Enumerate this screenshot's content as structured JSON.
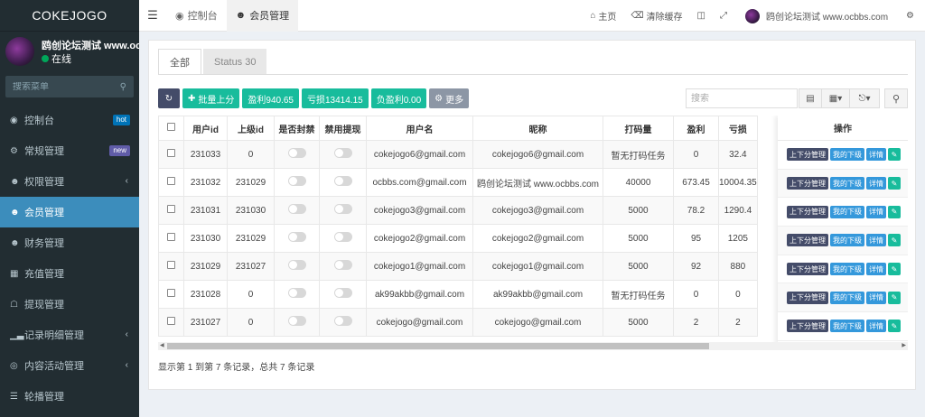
{
  "sidebar": {
    "logo": "COKEJOGO",
    "user_name": "鸥创论坛测试 www.ocbbs",
    "status": "在线",
    "search_placeholder": "搜索菜单",
    "items": [
      {
        "label": "控制台",
        "badge": "hot",
        "icon": "dashboard-icon"
      },
      {
        "label": "常规管理",
        "badge": "new",
        "icon": "cogs-icon"
      },
      {
        "label": "权限管理",
        "icon": "group-icon",
        "chevron": "‹"
      },
      {
        "label": "会员管理",
        "icon": "users-icon",
        "active": true
      },
      {
        "label": "财务管理",
        "icon": "users-icon"
      },
      {
        "label": "充值管理",
        "icon": "grid-icon"
      },
      {
        "label": "提现管理",
        "icon": "bank-icon"
      },
      {
        "label": "记录明细管理",
        "icon": "bar-chart-icon",
        "chevron": "‹"
      },
      {
        "label": "内容活动管理",
        "icon": "dribbble-icon",
        "chevron": "‹"
      },
      {
        "label": "轮播管理",
        "icon": "list-icon"
      }
    ]
  },
  "topbar": {
    "tabs": [
      {
        "label": "控制台",
        "icon": "dashboard-icon"
      },
      {
        "label": "会员管理",
        "icon": "users-icon"
      }
    ],
    "home": "主页",
    "clear_cache": "清除缓存",
    "user": "鸥创论坛测试 www.ocbbs.com"
  },
  "panel": {
    "tabs": [
      "全部",
      "Status 30"
    ],
    "toolbar": {
      "batch": "批量上分",
      "profit": "盈利940.65",
      "loss": "亏损13414.15",
      "negative": "负盈利0.00",
      "more": "更多"
    },
    "search_placeholder": "搜索",
    "columns": [
      "用户id",
      "上级id",
      "是否封禁",
      "禁用提现",
      "用户名",
      "昵称",
      "打码量",
      "盈利",
      "亏损"
    ],
    "ops_header": "操作",
    "ops_buttons": [
      "上下分管理",
      "我的下级",
      "详情"
    ],
    "rows": [
      {
        "id": "231033",
        "parent": "0",
        "username": "cokejogo6@gmail.com",
        "nickname": "cokejogo6@gmail.com",
        "bet": "暂无打码任务",
        "profit": "0",
        "loss": "32.4"
      },
      {
        "id": "231032",
        "parent": "231029",
        "username": "ocbbs.com@gmail.com",
        "nickname": "鸥创论坛测试 www.ocbbs.com",
        "bet": "40000",
        "profit": "673.45",
        "loss": "10004.35"
      },
      {
        "id": "231031",
        "parent": "231030",
        "username": "cokejogo3@gmail.com",
        "nickname": "cokejogo3@gmail.com",
        "bet": "5000",
        "profit": "78.2",
        "loss": "1290.4"
      },
      {
        "id": "231030",
        "parent": "231029",
        "username": "cokejogo2@gmail.com",
        "nickname": "cokejogo2@gmail.com",
        "bet": "5000",
        "profit": "95",
        "loss": "1205"
      },
      {
        "id": "231029",
        "parent": "231027",
        "username": "cokejogo1@gmail.com",
        "nickname": "cokejogo1@gmail.com",
        "bet": "5000",
        "profit": "92",
        "loss": "880"
      },
      {
        "id": "231028",
        "parent": "0",
        "username": "ak99akbb@gmail.com",
        "nickname": "ak99akbb@gmail.com",
        "bet": "暂无打码任务",
        "profit": "0",
        "loss": "0"
      },
      {
        "id": "231027",
        "parent": "0",
        "username": "cokejogo@gmail.com",
        "nickname": "cokejogo@gmail.com",
        "bet": "5000",
        "profit": "2",
        "loss": "2"
      }
    ],
    "pagination_info": "显示第 1 到第 7 条记录，总共 7 条记录"
  }
}
